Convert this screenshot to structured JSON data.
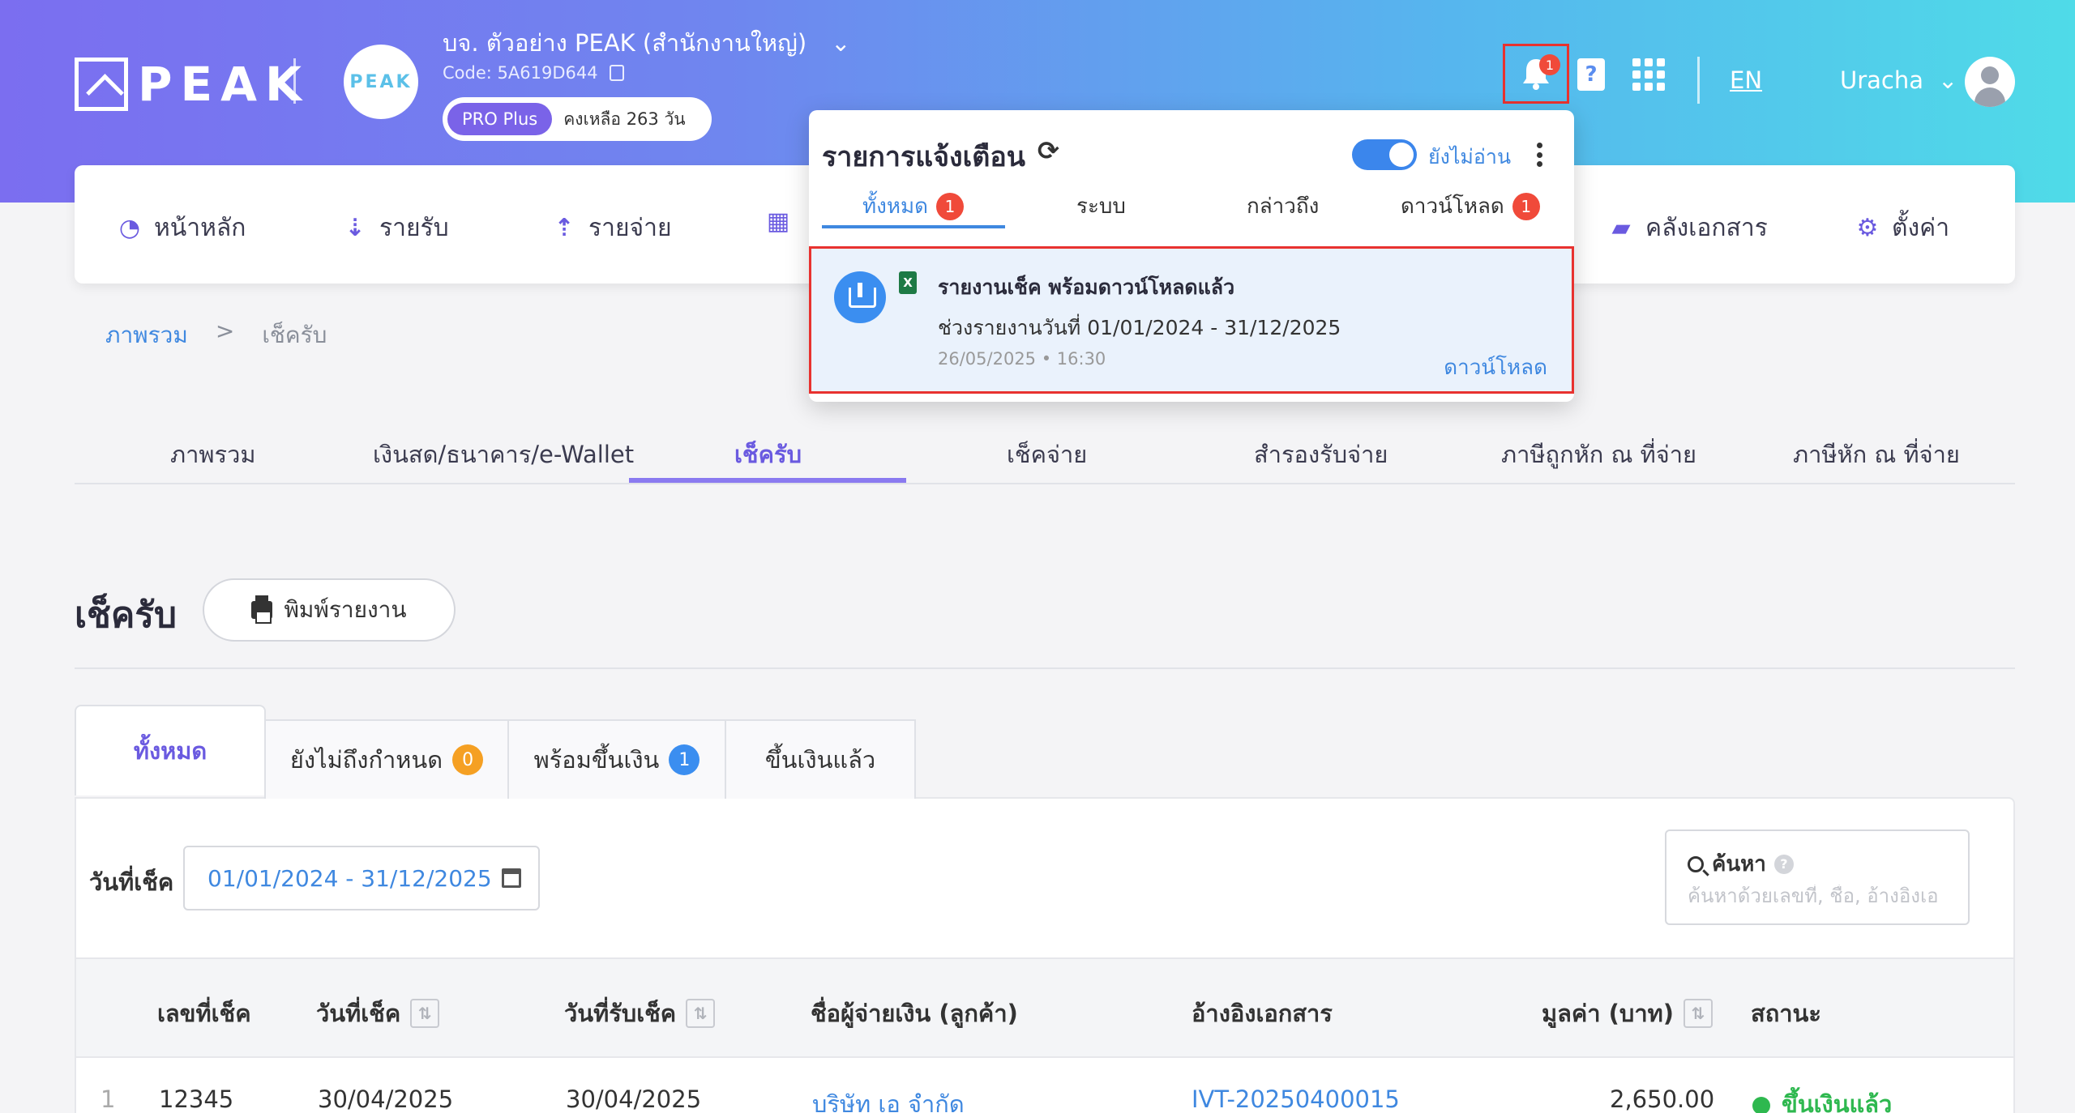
{
  "header": {
    "logo_text": "PEAK",
    "company_avatar_text": "PEAK",
    "company_name": "บจ. ตัวอย่าง PEAK (สำนักงานใหญ่)",
    "company_code": "Code: 5A619D644",
    "plan_badge": "PRO Plus",
    "plan_days": "คงเหลือ 263 วัน",
    "notification_count": "1",
    "help_symbol": "?",
    "language": "EN",
    "user_name": "Uracha"
  },
  "nav": {
    "items": [
      {
        "label": "หน้าหลัก",
        "icon": "chart-gauge-icon"
      },
      {
        "label": "รายรับ",
        "icon": "income-list-icon"
      },
      {
        "label": "รายจ่าย",
        "icon": "expense-list-icon"
      },
      {
        "label": "",
        "icon": "building-icon"
      },
      {
        "label": "คลังเอกสาร",
        "icon": "folder-open-icon"
      },
      {
        "label": "ตั้งค่า",
        "icon": "gear-icon"
      }
    ]
  },
  "breadcrumb": {
    "root": "ภาพรวม",
    "separator": ">",
    "current": "เช็ครับ"
  },
  "subtabs": [
    "ภาพรวม",
    "เงินสด/ธนาคาร/e-Wallet",
    "เช็ครับ",
    "เช็คจ่าย",
    "สำรองรับจ่าย",
    "ภาษีถูกหัก ณ ที่จ่าย",
    "ภาษีหัก ณ ที่จ่าย"
  ],
  "page": {
    "title": "เช็ครับ",
    "print_label": "พิมพ์รายงาน"
  },
  "status_tabs": [
    {
      "label": "ทั้งหมด",
      "count": null
    },
    {
      "label": "ยังไม่ถึงกำหนด",
      "count": "0",
      "color": "#f5a023"
    },
    {
      "label": "พร้อมขึ้นเงิน",
      "count": "1",
      "color": "#3b8ef0"
    },
    {
      "label": "ขึ้นเงินแล้ว",
      "count": null
    }
  ],
  "filters": {
    "date_label": "วันที่เช็ค",
    "date_range": "01/01/2024 - 31/12/2025",
    "search_label": "ค้นหา",
    "search_placeholder": "ค้นหาด้วยเลขที่, ชื่อ, อ้างอิงเอ"
  },
  "table": {
    "columns": [
      "เลขที่เช็ค",
      "วันที่เช็ค",
      "วันที่รับเช็ค",
      "ชื่อผู้จ่ายเงิน (ลูกค้า)",
      "อ้างอิงเอกสาร",
      "มูลค่า (บาท)",
      "สถานะ"
    ],
    "rows": [
      {
        "index": "1",
        "cheque_no": "12345",
        "cheque_date": "30/04/2025",
        "received_date": "30/04/2025",
        "payer": "บริษัท เอ จำกัด",
        "reference": "IVT-20250400015",
        "amount": "2,650.00",
        "status": "ขึ้นเงินแล้ว"
      }
    ]
  },
  "notifications": {
    "title": "รายการแจ้งเตือน",
    "unread_toggle_label": "ยังไม่อ่าน",
    "tabs": [
      {
        "label": "ทั้งหมด",
        "count": "1"
      },
      {
        "label": "ระบบ",
        "count": null
      },
      {
        "label": "กล่าวถึง",
        "count": null
      },
      {
        "label": "ดาวน์โหลด",
        "count": "1"
      }
    ],
    "item": {
      "file_type": "X",
      "heading": "รายงานเช็ค พร้อมดาวน์โหลดแล้ว",
      "description": "ช่วงรายงานวันที่ 01/01/2024 - 31/12/2025",
      "timestamp": "26/05/2025 • 16:30",
      "action": "ดาวน์โหลด"
    }
  },
  "colors": {
    "accent": "#6a5ae0",
    "link": "#3f88e0",
    "alert": "#e8322f",
    "success": "#2eb84f"
  }
}
